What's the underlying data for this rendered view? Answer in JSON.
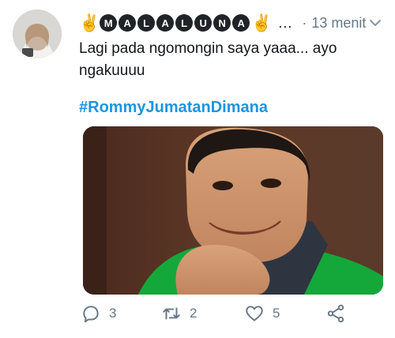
{
  "tweet": {
    "author_badges": [
      "M",
      "A",
      "L",
      "A",
      "L",
      "U",
      "N",
      "A"
    ],
    "ellipsis": "...",
    "separator": "·",
    "time": "13 menit",
    "text": "Lagi pada ngomongin saya yaaa... ayo\nngakuuuu",
    "hashtag": "#RommyJumatanDimana"
  },
  "actions": {
    "reply_count": "3",
    "retweet_count": "2",
    "like_count": "5"
  },
  "icons": {
    "reply": "reply-icon",
    "retweet": "retweet-icon",
    "like": "heart-icon",
    "share": "share-icon",
    "menu": "chevron-down-icon"
  },
  "colors": {
    "hashtag": "#1b95e0",
    "muted": "#657786",
    "text": "#14171a",
    "badge": "#202327",
    "emoji": "#f6b93b"
  }
}
